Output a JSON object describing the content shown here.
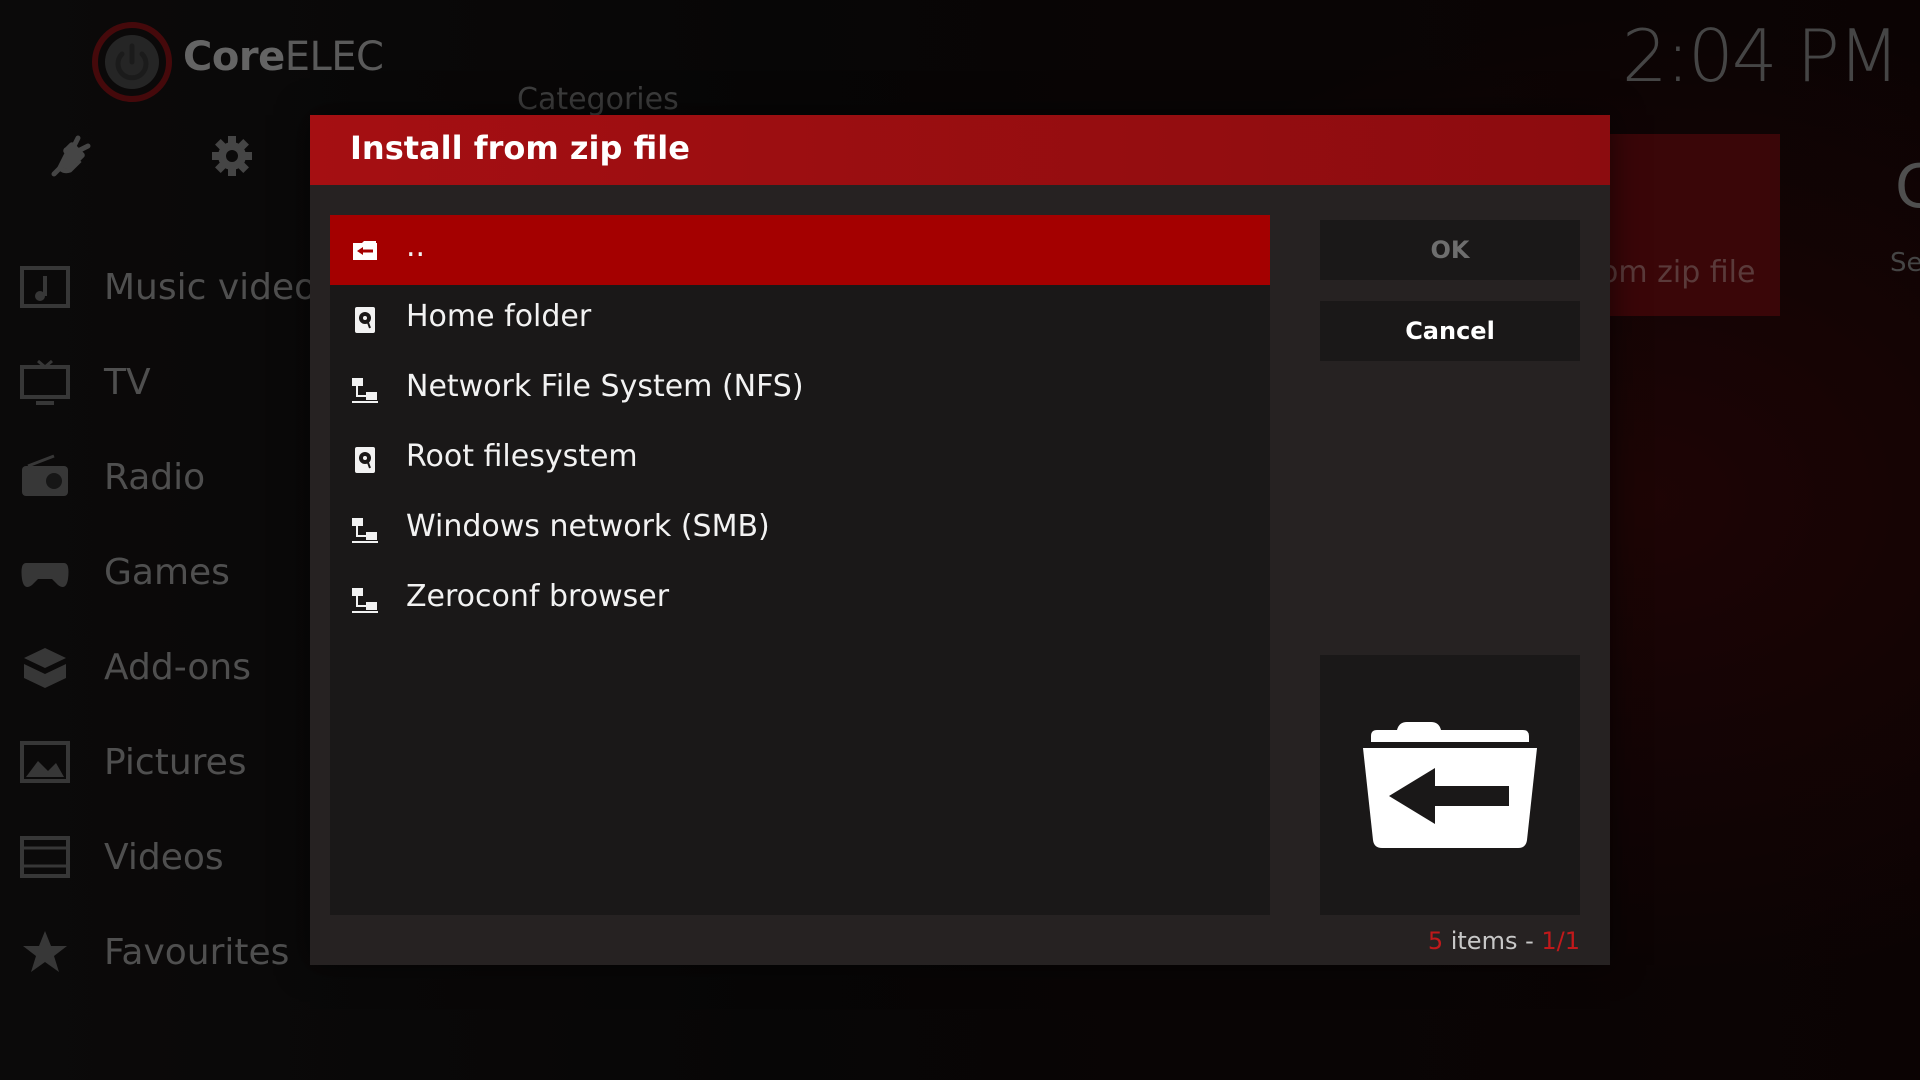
{
  "app": {
    "brand_bold": "Core",
    "brand_light": "ELEC",
    "clock": "2:04 PM"
  },
  "background": {
    "categories_label": "Categories",
    "main_menu": [
      {
        "label": "Music videos",
        "icon": "music-video-icon"
      },
      {
        "label": "TV",
        "icon": "tv-icon"
      },
      {
        "label": "Radio",
        "icon": "radio-icon"
      },
      {
        "label": "Games",
        "icon": "gamepad-icon"
      },
      {
        "label": "Add-ons",
        "icon": "addons-box-icon"
      },
      {
        "label": "Pictures",
        "icon": "picture-icon"
      },
      {
        "label": "Videos",
        "icon": "film-strip-icon"
      },
      {
        "label": "Favourites",
        "icon": "star-icon"
      }
    ],
    "tile_label": "om zip file",
    "tile2_label": "Se"
  },
  "dialog": {
    "title": "Install from zip file",
    "items": [
      {
        "label": "..",
        "icon": "folder-back-icon",
        "selected": true
      },
      {
        "label": "Home folder",
        "icon": "hard-drive-icon",
        "selected": false
      },
      {
        "label": "Network File System (NFS)",
        "icon": "network-icon",
        "selected": false
      },
      {
        "label": "Root filesystem",
        "icon": "hard-drive-icon",
        "selected": false
      },
      {
        "label": "Windows network (SMB)",
        "icon": "network-icon",
        "selected": false
      },
      {
        "label": "Zeroconf browser",
        "icon": "network-icon",
        "selected": false
      }
    ],
    "ok_label": "OK",
    "cancel_label": "Cancel",
    "preview_icon": "folder-back-icon",
    "item_count": "5",
    "items_word": " items - ",
    "page": "1/1"
  },
  "colors": {
    "accent": "#a40000",
    "header": "#a50f12",
    "dialog_bg": "#262222",
    "list_bg": "#1a1818"
  }
}
